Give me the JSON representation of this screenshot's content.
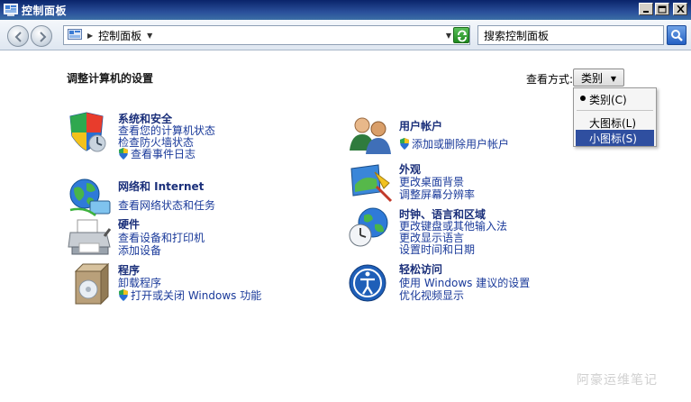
{
  "window": {
    "title": "控制面板"
  },
  "address": {
    "breadcrumb": "控制面板",
    "search_placeholder": "搜索控制面板"
  },
  "main": {
    "heading": "调整计算机的设置",
    "view_by_label": "查看方式:",
    "view_by_value": "类别",
    "view_menu": [
      {
        "label": "类别(C)",
        "selected": true
      },
      {
        "label": "大图标(L)",
        "selected": false
      },
      {
        "label": "小图标(S)",
        "selected": false,
        "highlighted": true
      }
    ]
  },
  "categories": {
    "system_security": {
      "icon": "system-security-shield-icon",
      "title": "系统和安全",
      "links": [
        "查看您的计算机状态",
        "检查防火墙状态",
        "查看事件日志"
      ]
    },
    "network": {
      "icon": "network-globe-icon",
      "title": "网络和 Internet",
      "links": [
        "查看网络状态和任务"
      ]
    },
    "hardware": {
      "icon": "printer-icon",
      "title": "硬件",
      "links": [
        "查看设备和打印机",
        "添加设备"
      ]
    },
    "programs": {
      "icon": "programs-box-icon",
      "title": "程序",
      "links": [
        "卸载程序",
        "打开或关闭 Windows 功能"
      ]
    },
    "user_accounts": {
      "icon": "users-icon",
      "title": "用户帐户",
      "links": [
        "添加或删除用户帐户"
      ]
    },
    "appearance": {
      "icon": "appearance-monitor-icon",
      "title": "外观",
      "links": [
        "更改桌面背景",
        "调整屏幕分辨率"
      ]
    },
    "clock_region": {
      "icon": "clock-globe-icon",
      "title": "时钟、语言和区域",
      "links": [
        "更改键盘或其他输入法",
        "更改显示语言",
        "设置时间和日期"
      ]
    },
    "ease_access": {
      "icon": "ease-of-access-icon",
      "title": "轻松访问",
      "links": [
        "使用 Windows 建议的设置",
        "优化视频显示"
      ]
    }
  },
  "watermark": "阿豪运维笔记"
}
